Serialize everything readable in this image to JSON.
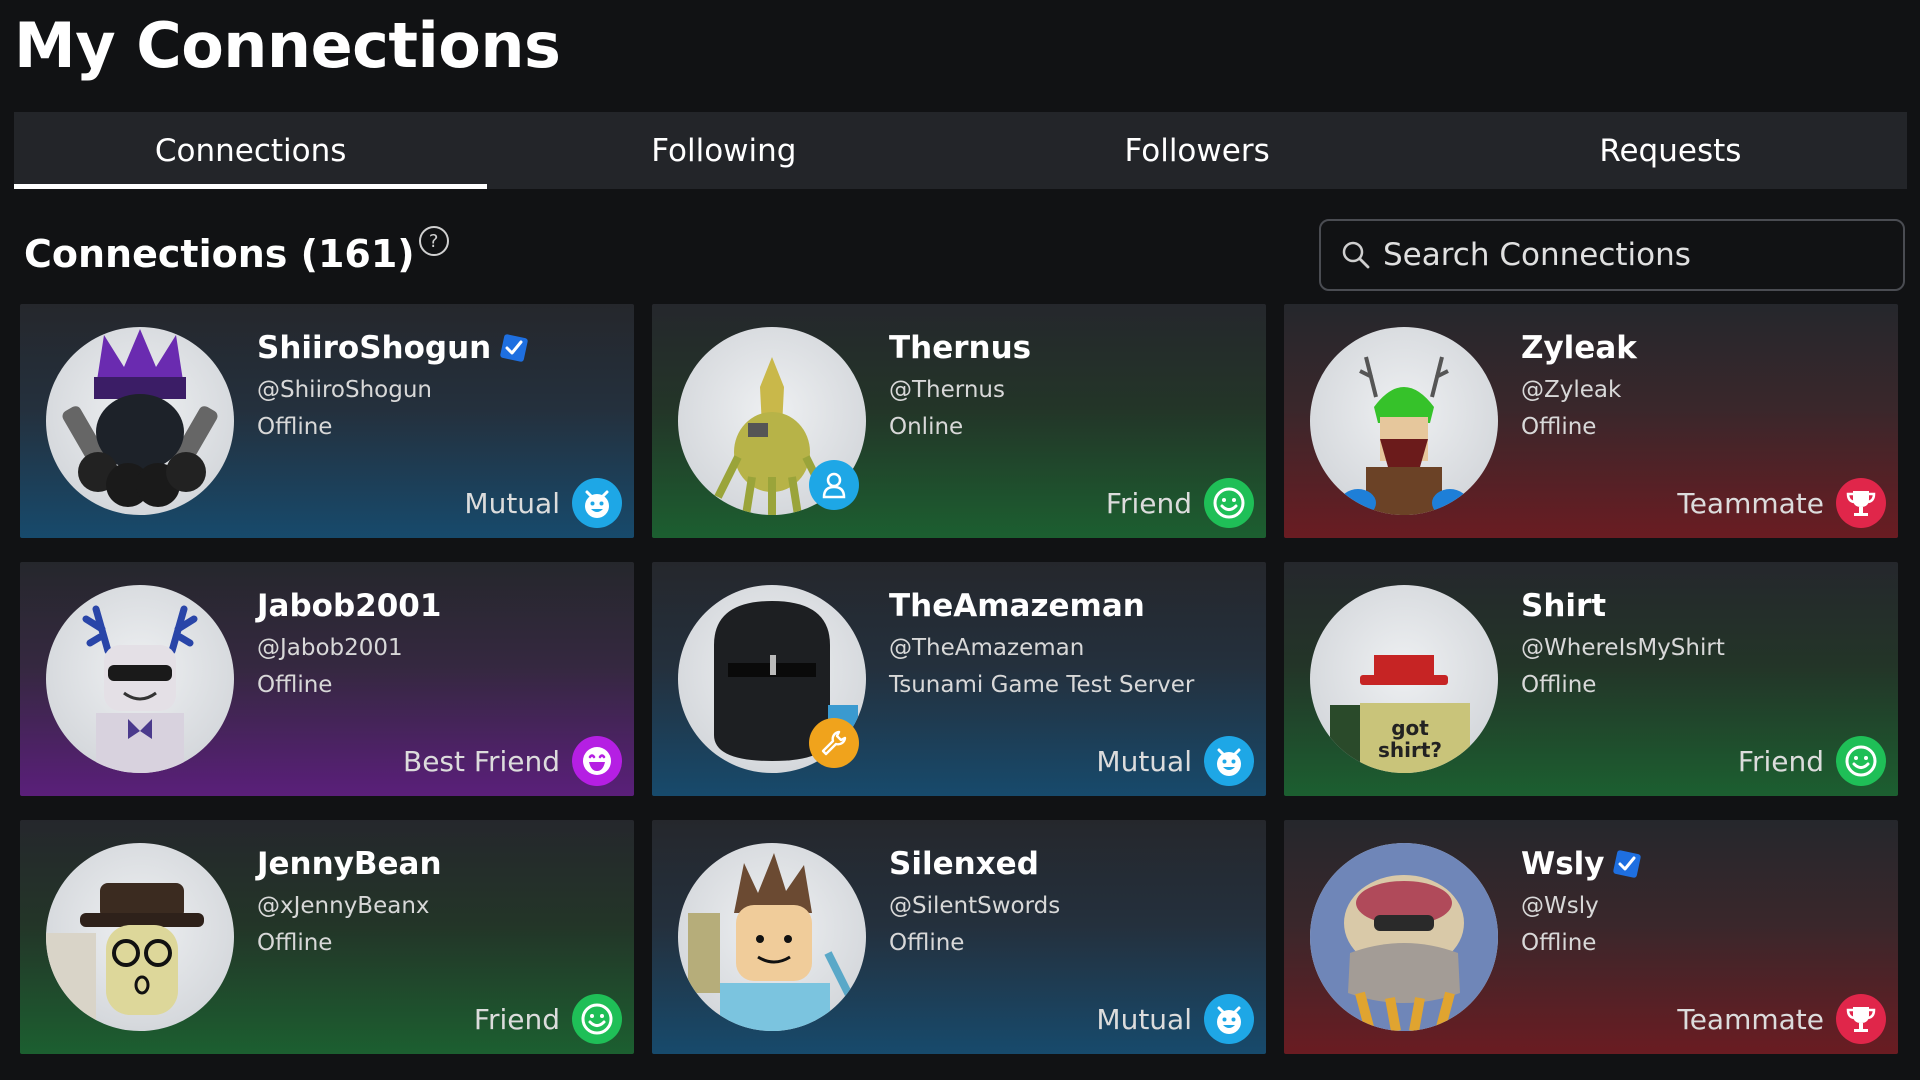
{
  "page": {
    "title": "My Connections"
  },
  "tabs": [
    {
      "label": "Connections",
      "active": true
    },
    {
      "label": "Following",
      "active": false
    },
    {
      "label": "Followers",
      "active": false
    },
    {
      "label": "Requests",
      "active": false
    }
  ],
  "section": {
    "title": "Connections (161)",
    "help_icon": "question-circle-icon"
  },
  "search": {
    "placeholder": "Search Connections",
    "value": "",
    "icon": "search-icon"
  },
  "colors": {
    "background": "#111214",
    "tab_bar": "#232529",
    "mutual": "#1ea7e6",
    "friend": "#1fbf57",
    "teammate": "#e0264a",
    "best_friend": "#b51fe3",
    "verified": "#1e6fe0",
    "presence_online": "#1ea7e6",
    "presence_studio": "#f0a31c"
  },
  "connections": [
    {
      "display_name": "ShiiroShogun",
      "username": "@ShiiroShogun",
      "status": "Offline",
      "relation": "Mutual",
      "relation_icon": "mutual-smile-icon",
      "verified": true
    },
    {
      "display_name": "Thernus",
      "username": "@Thernus",
      "status": "Online",
      "relation": "Friend",
      "relation_icon": "friend-smile-icon",
      "presence_icon": "online-user-icon"
    },
    {
      "display_name": "Zyleak",
      "username": "@Zyleak",
      "status": "Offline",
      "relation": "Teammate",
      "relation_icon": "trophy-icon"
    },
    {
      "display_name": "Jabob2001",
      "username": "@Jabob2001",
      "status": "Offline",
      "relation": "Best Friend",
      "relation_icon": "best-friend-grin-icon"
    },
    {
      "display_name": "TheAmazeman",
      "username": "@TheAmazeman",
      "status": "Tsunami Game Test Server",
      "relation": "Mutual",
      "relation_icon": "mutual-smile-icon",
      "presence_icon": "studio-wrench-icon"
    },
    {
      "display_name": "Shirt",
      "username": "@WhereIsMyShirt",
      "status": "Offline",
      "relation": "Friend",
      "relation_icon": "friend-smile-icon",
      "avatar_text": "got shirt?"
    },
    {
      "display_name": "JennyBean",
      "username": "@xJennyBeanx",
      "status": "Offline",
      "relation": "Friend",
      "relation_icon": "friend-smile-icon"
    },
    {
      "display_name": "Silenxed",
      "username": "@SilentSwords",
      "status": "Offline",
      "relation": "Mutual",
      "relation_icon": "mutual-smile-icon"
    },
    {
      "display_name": "Wsly",
      "username": "@Wsly",
      "status": "Offline",
      "relation": "Teammate",
      "relation_icon": "trophy-icon",
      "verified": true
    }
  ]
}
